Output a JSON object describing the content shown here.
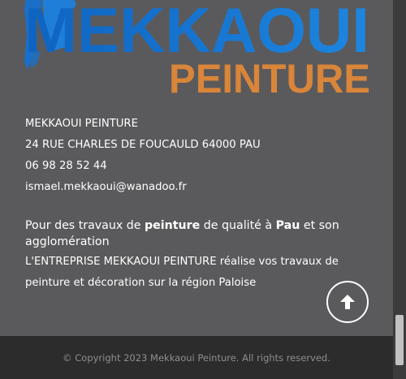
{
  "logo": {
    "line1": "MEKKAOUI",
    "line2": "PEINTURE",
    "color_blue": "#1a78d2",
    "color_orange": "#d9853a"
  },
  "contact": {
    "company": "MEKKAOUI PEINTURE",
    "address": "24 RUE CHARLES DE FOUCAULD 64000 PAU",
    "phone": "06 98 28 52 44",
    "email": "ismael.mekkaoui@wanadoo.fr"
  },
  "description": {
    "intro_1": "Pour des travaux de ",
    "intro_bold_1": "peinture",
    "intro_2": " de qualité à ",
    "intro_bold_2": "Pau",
    "intro_3": " et son agglomération",
    "body": "L'ENTREPRISE MEKKAOUI PEINTURE réalise vos travaux de peinture et décoration sur la région Paloise"
  },
  "back_to_top_icon": "arrow-up-icon",
  "footer": {
    "copyright": "© Copyright 2023 Mekkaoui Peinture. All rights reserved."
  }
}
